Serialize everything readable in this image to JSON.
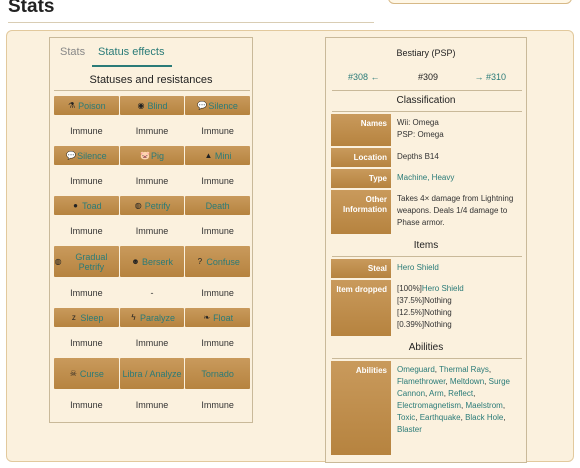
{
  "page": {
    "heading": "Stats"
  },
  "tabs": {
    "stats": "Stats",
    "status_effects": "Status effects"
  },
  "statuses": {
    "title": "Statuses and resistances",
    "rows": [
      {
        "tall": false,
        "cells": [
          {
            "icon": "poison-icon",
            "glyph": "⚗",
            "label": "Poison",
            "value": "Immune"
          },
          {
            "icon": "blind-icon",
            "glyph": "◉",
            "label": "Blind",
            "value": "Immune"
          },
          {
            "icon": "silence-icon",
            "glyph": "💬",
            "label": "Silence",
            "value": "Immune"
          }
        ]
      },
      {
        "tall": false,
        "cells": [
          {
            "icon": "silence-icon",
            "glyph": "💬",
            "label": "Silence",
            "value": "Immune"
          },
          {
            "icon": "pig-icon",
            "glyph": "🐷",
            "label": "Pig",
            "value": "Immune"
          },
          {
            "icon": "mini-icon",
            "glyph": "▲",
            "label": "Mini",
            "value": "Immune"
          }
        ]
      },
      {
        "tall": false,
        "cells": [
          {
            "icon": "toad-icon",
            "glyph": "●",
            "label": "Toad",
            "value": "Immune"
          },
          {
            "icon": "petrify-icon",
            "glyph": "◍",
            "label": "Petrify",
            "value": "Immune"
          },
          {
            "icon": "",
            "glyph": "",
            "label": "Death",
            "value": "Immune"
          }
        ]
      },
      {
        "tall": true,
        "cells": [
          {
            "icon": "gradual-petrify-icon",
            "glyph": "◍",
            "label": "Gradual Petrify",
            "value": "Immune"
          },
          {
            "icon": "berserk-icon",
            "glyph": "☻",
            "label": "Berserk",
            "value": "-"
          },
          {
            "icon": "confuse-icon",
            "glyph": "?",
            "label": "Confuse",
            "value": "Immune"
          }
        ]
      },
      {
        "tall": false,
        "cells": [
          {
            "icon": "sleep-icon",
            "glyph": "z",
            "label": "Sleep",
            "value": "Immune"
          },
          {
            "icon": "paralyze-icon",
            "glyph": "ϟ",
            "label": "Paralyze",
            "value": "Immune"
          },
          {
            "icon": "float-icon",
            "glyph": "❧",
            "label": "Float",
            "value": "Immune"
          }
        ]
      },
      {
        "tall": true,
        "cells": [
          {
            "icon": "curse-icon",
            "glyph": "☠",
            "label": "Curse",
            "value": "Immune"
          },
          {
            "icon": "",
            "glyph": "",
            "label": "Libra / Analyze",
            "value": "Immune"
          },
          {
            "icon": "",
            "glyph": "",
            "label": "Tornado",
            "value": "Immune"
          }
        ]
      }
    ]
  },
  "bestiary": {
    "title": "Bestiary (PSP)",
    "prev": "#308 ←",
    "current": "#309",
    "next": "→ #310",
    "classification_title": "Classification",
    "names_label": "Names",
    "names_wii": "Wii: Omega",
    "names_psp": "PSP: Omega",
    "location_label": "Location",
    "location_value": "Depths B14",
    "type_label": "Type",
    "type_value": "Machine, Heavy",
    "other_label": "Other Information",
    "other_value": "Takes 4× damage from Lightning weapons. Deals 1/4 damage to Phase armor.",
    "items_title": "Items",
    "steal_label": "Steal",
    "steal_value": "Hero Shield",
    "drop_label": "Item dropped",
    "drops": [
      {
        "pct": "[100%]",
        "item": "Hero Shield",
        "link": true
      },
      {
        "pct": "[37.5%]",
        "item": "Nothing",
        "link": false
      },
      {
        "pct": "[12.5%]",
        "item": "Nothing",
        "link": false
      },
      {
        "pct": "[0.39%]",
        "item": "Nothing",
        "link": false
      }
    ],
    "abilities_title": "Abilities",
    "abilities_label": "Abilities",
    "abilities": [
      "Omeguard",
      "Thermal Rays",
      "Flamethrower",
      "Meltdown",
      "Surge Cannon",
      "Arm",
      "Reflect",
      "Electromagnetism",
      "Maelstrom",
      "Toxic",
      "Earthquake",
      "Black Hole",
      "Blaster"
    ]
  },
  "colors": {
    "accent": "#2a7b78",
    "tile": "#c0904f",
    "panel_bg": "#fbf1de"
  }
}
